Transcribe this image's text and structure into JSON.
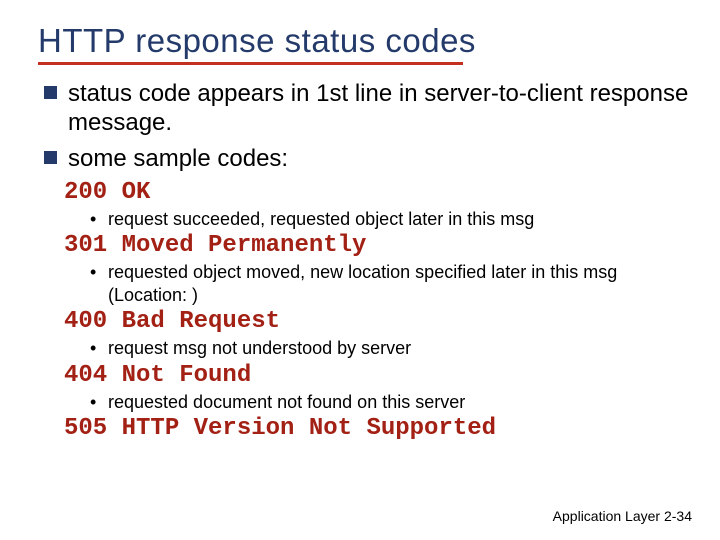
{
  "title": "HTTP response status codes",
  "bullets": [
    "status code appears in 1st line in server-to-client response message.",
    "some sample codes:"
  ],
  "codes": [
    {
      "code": "200 OK",
      "desc": "request succeeded, requested object later in this msg"
    },
    {
      "code": "301 Moved Permanently",
      "desc": "requested object moved, new location specified later in this msg (Location: )"
    },
    {
      "code": "400 Bad Request",
      "desc": "request msg not understood by server"
    },
    {
      "code": "404 Not Found",
      "desc": "requested document not found on this server"
    },
    {
      "code": "505 HTTP Version Not Supported",
      "desc": ""
    }
  ],
  "footer": {
    "section": "Application Layer",
    "page": "2-34"
  }
}
